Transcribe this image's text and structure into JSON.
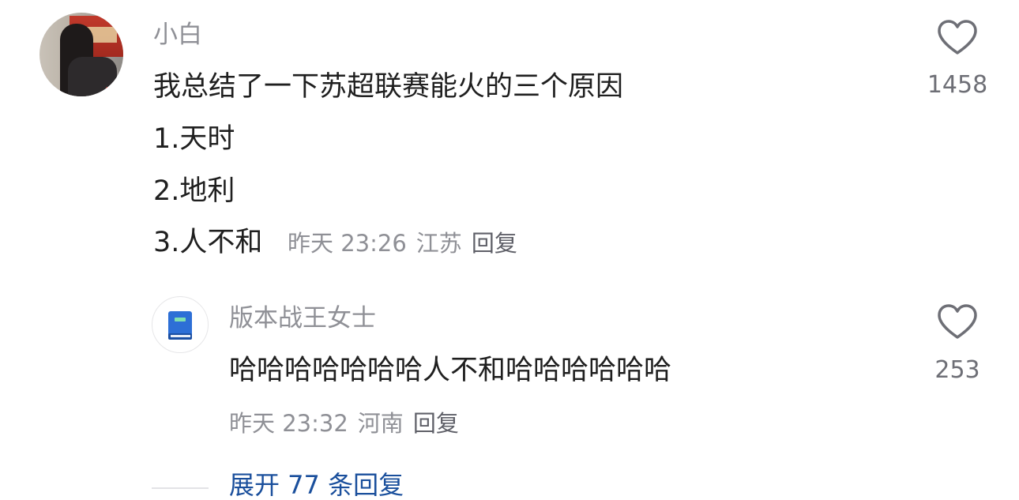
{
  "comment": {
    "username": "小白",
    "text_line1": "我总结了一下苏超联赛能火的三个原因",
    "text_line2": "1.天时",
    "text_line3": "2.地利",
    "text_line4": "3.人不和",
    "time": "昨天 23:26",
    "location": "江苏",
    "reply_label": "回复",
    "likes": "1458"
  },
  "reply": {
    "username": "版本战王女士",
    "text": "哈哈哈哈哈哈哈人不和哈哈哈哈哈哈",
    "time": "昨天 23:32",
    "location": "河南",
    "reply_label": "回复",
    "likes": "253"
  },
  "expand": {
    "label": "展开 77 条回复"
  },
  "colors": {
    "link": "#1a4f9c",
    "muted": "#8f9096",
    "text": "#1f1f1f"
  }
}
